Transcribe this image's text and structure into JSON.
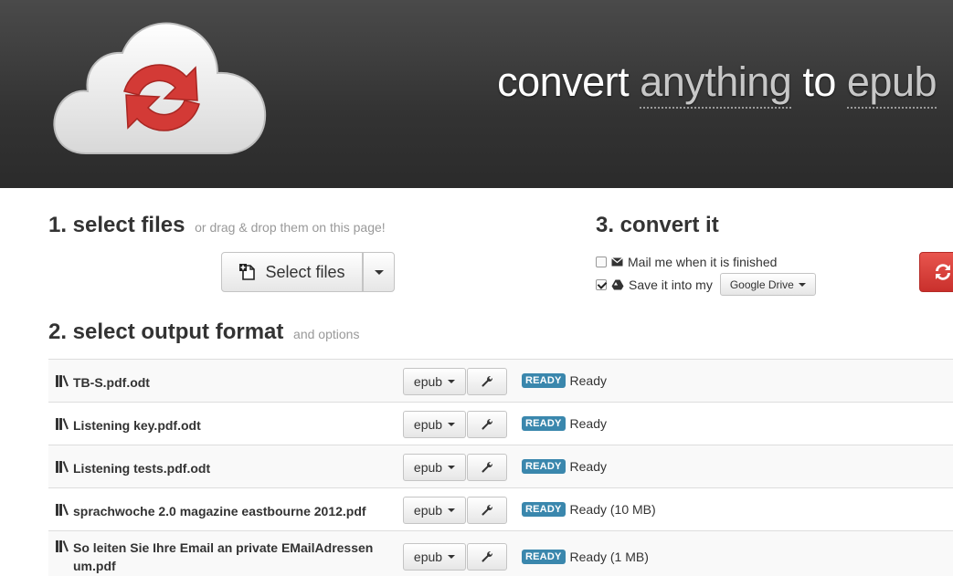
{
  "header": {
    "tagline": {
      "w1": "convert",
      "w2": "anything",
      "w3": "to",
      "w4": "epub"
    },
    "logo_icon": "cloud-refresh-icon"
  },
  "select_files": {
    "heading": "1. select files",
    "hint": "or drag & drop them on this page!",
    "button_label": "Select files",
    "button_icon": "add-file-icon"
  },
  "convert": {
    "heading": "3. convert it",
    "mail_label": "Mail me when it is finished",
    "mail_checked": false,
    "save_label": "Save it into my",
    "save_checked": true,
    "drive_button": "Google Drive",
    "button_icon": "refresh-icon"
  },
  "output_format": {
    "heading": "2. select output format",
    "hint": "and options"
  },
  "files": [
    {
      "name": "TB-S.pdf.odt",
      "format": "epub",
      "badge": "READY",
      "status": "Ready"
    },
    {
      "name": "Listening key.pdf.odt",
      "format": "epub",
      "badge": "READY",
      "status": "Ready"
    },
    {
      "name": "Listening tests.pdf.odt",
      "format": "epub",
      "badge": "READY",
      "status": "Ready"
    },
    {
      "name": "sprachwoche 2.0 magazine eastbourne 2012.pdf",
      "format": "epub",
      "badge": "READY",
      "status": "Ready (10 MB)"
    },
    {
      "name": "So leiten Sie Ihre Email an private EMailAdressen um.pdf",
      "format": "epub",
      "badge": "READY",
      "status": "Ready (1 MB)"
    }
  ],
  "colors": {
    "header_bg": "#333333",
    "badge": "#3a87ad",
    "convert_button": "#d9534f",
    "logo_arrows": "#d33a36"
  }
}
